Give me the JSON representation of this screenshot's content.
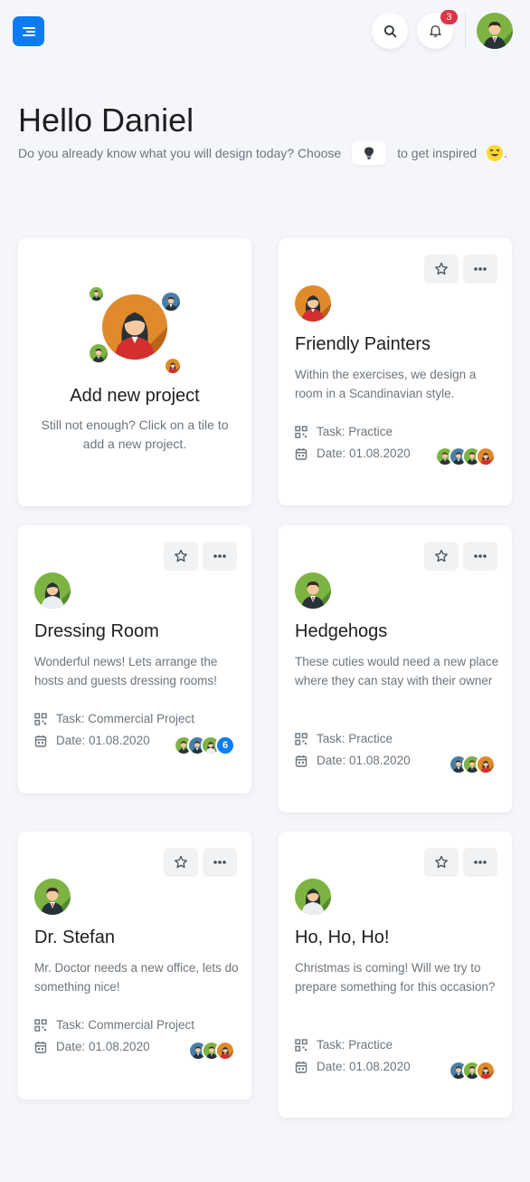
{
  "header": {
    "notification_count": "3",
    "accent": "#0d7cf2"
  },
  "greeting": {
    "title": "Hello Daniel",
    "prompt_before": "Do you already know what you will design today? Choose",
    "prompt_after": "to get inspired",
    "prompt_end": "."
  },
  "add_project": {
    "title": "Add new project",
    "description": "Still not enough? Click on a tile to add a new project."
  },
  "projects": [
    {
      "title": "Friendly Painters",
      "description": "Within the exercises, we design a room in a Scandinavian style.",
      "task": "Task: Practice",
      "date": "Date: 01.08.2020",
      "extra_members": ""
    },
    {
      "title": "Dressing Room",
      "description": "Wonderful news! Lets arrange the hosts and guests dressing rooms!",
      "task": "Task: Commercial Project",
      "date": "Date: 01.08.2020",
      "extra_members": "6"
    },
    {
      "title": "Hedgehogs",
      "description": "These cuties would need a new place where they can stay with their owner",
      "task": "Task: Practice",
      "date": "Date: 01.08.2020",
      "extra_members": ""
    },
    {
      "title": "Dr. Stefan",
      "description": "Mr. Doctor needs a new office, lets do something nice!",
      "task": "Task: Commercial Project",
      "date": "Date: 01.08.2020",
      "extra_members": ""
    },
    {
      "title": "Ho, Ho, Ho!",
      "description": "Christmas is coming! Will we try to prepare something for this occasion?",
      "task": "Task: Practice",
      "date": "Date: 01.08.2020",
      "extra_members": ""
    }
  ]
}
